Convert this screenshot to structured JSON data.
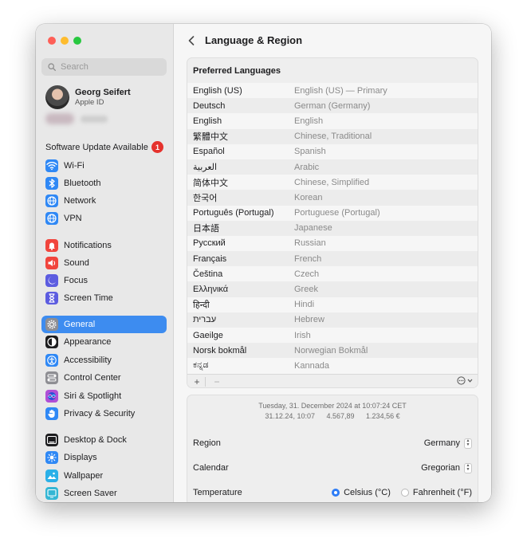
{
  "search": {
    "placeholder": "Search"
  },
  "profile": {
    "name": "Georg Seifert",
    "subtitle": "Apple ID"
  },
  "family": {
    "label": "Family"
  },
  "update": {
    "label": "Software Update Available",
    "count": "1"
  },
  "sidebar": {
    "groups": [
      {
        "items": [
          {
            "label": "Wi-Fi",
            "icon": "wifi-icon",
            "color": "#2f88f5"
          },
          {
            "label": "Bluetooth",
            "icon": "bluetooth-icon",
            "color": "#2f88f5"
          },
          {
            "label": "Network",
            "icon": "globe-icon",
            "color": "#2f88f5"
          },
          {
            "label": "VPN",
            "icon": "vpn-globe-icon",
            "color": "#2f88f5"
          }
        ]
      },
      {
        "items": [
          {
            "label": "Notifications",
            "icon": "bell-icon",
            "color": "#f1453d"
          },
          {
            "label": "Sound",
            "icon": "speaker-icon",
            "color": "#f1453d"
          },
          {
            "label": "Focus",
            "icon": "moon-icon",
            "color": "#5c5ce0"
          },
          {
            "label": "Screen Time",
            "icon": "hourglass-icon",
            "color": "#5c5ce0"
          }
        ]
      },
      {
        "items": [
          {
            "label": "General",
            "icon": "gear-icon",
            "color": "#8e8e93",
            "selected": true
          },
          {
            "label": "Appearance",
            "icon": "appearance-icon",
            "color": "#1d1d1f"
          },
          {
            "label": "Accessibility",
            "icon": "accessibility-icon",
            "color": "#2f88f5"
          },
          {
            "label": "Control Center",
            "icon": "control-center-icon",
            "color": "#8e8e93"
          },
          {
            "label": "Siri & Spotlight",
            "icon": "siri-icon",
            "color": "#b04fd6"
          },
          {
            "label": "Privacy & Security",
            "icon": "hand-icon",
            "color": "#2f88f5"
          }
        ]
      },
      {
        "items": [
          {
            "label": "Desktop & Dock",
            "icon": "dock-icon",
            "color": "#1d1d1f"
          },
          {
            "label": "Displays",
            "icon": "sun-icon",
            "color": "#2f88f5"
          },
          {
            "label": "Wallpaper",
            "icon": "wallpaper-icon",
            "color": "#2ab0e8"
          },
          {
            "label": "Screen Saver",
            "icon": "screensaver-icon",
            "color": "#34b6d4"
          }
        ]
      }
    ]
  },
  "header": {
    "title": "Language & Region"
  },
  "languages": {
    "heading": "Preferred Languages",
    "rows": [
      {
        "native": "English (US)",
        "english": "English (US) — Primary"
      },
      {
        "native": "Deutsch",
        "english": "German (Germany)"
      },
      {
        "native": "English",
        "english": "English"
      },
      {
        "native": "繁體中文",
        "english": "Chinese, Traditional"
      },
      {
        "native": "Español",
        "english": "Spanish"
      },
      {
        "native": "العربية",
        "english": "Arabic"
      },
      {
        "native": "简体中文",
        "english": "Chinese, Simplified"
      },
      {
        "native": "한국어",
        "english": "Korean"
      },
      {
        "native": "Português (Portugal)",
        "english": "Portuguese (Portugal)"
      },
      {
        "native": "日本語",
        "english": "Japanese"
      },
      {
        "native": "Русский",
        "english": "Russian"
      },
      {
        "native": "Français",
        "english": "French"
      },
      {
        "native": "Čeština",
        "english": "Czech"
      },
      {
        "native": "Ελληνικά",
        "english": "Greek"
      },
      {
        "native": "हिन्दी",
        "english": "Hindi"
      },
      {
        "native": "עברית",
        "english": "Hebrew"
      },
      {
        "native": "Gaeilge",
        "english": "Irish"
      },
      {
        "native": "Norsk bokmål",
        "english": "Norwegian Bokmål"
      },
      {
        "native": "ಕನ್ನಡ",
        "english": "Kannada"
      }
    ],
    "add_label": "+",
    "remove_label": "−"
  },
  "region_settings": {
    "preview_date": "Tuesday, 31. December 2024 at 10:07:24 CET",
    "preview_short": "31.12.24, 10:07",
    "preview_number": "4.567,89",
    "preview_currency": "1.234,56 €",
    "region": {
      "label": "Region",
      "value": "Germany"
    },
    "calendar": {
      "label": "Calendar",
      "value": "Gregorian"
    },
    "temperature": {
      "label": "Temperature",
      "options": [
        {
          "label": "Celsius (°C)",
          "selected": true
        },
        {
          "label": "Fahrenheit (°F)",
          "selected": false
        }
      ]
    }
  }
}
